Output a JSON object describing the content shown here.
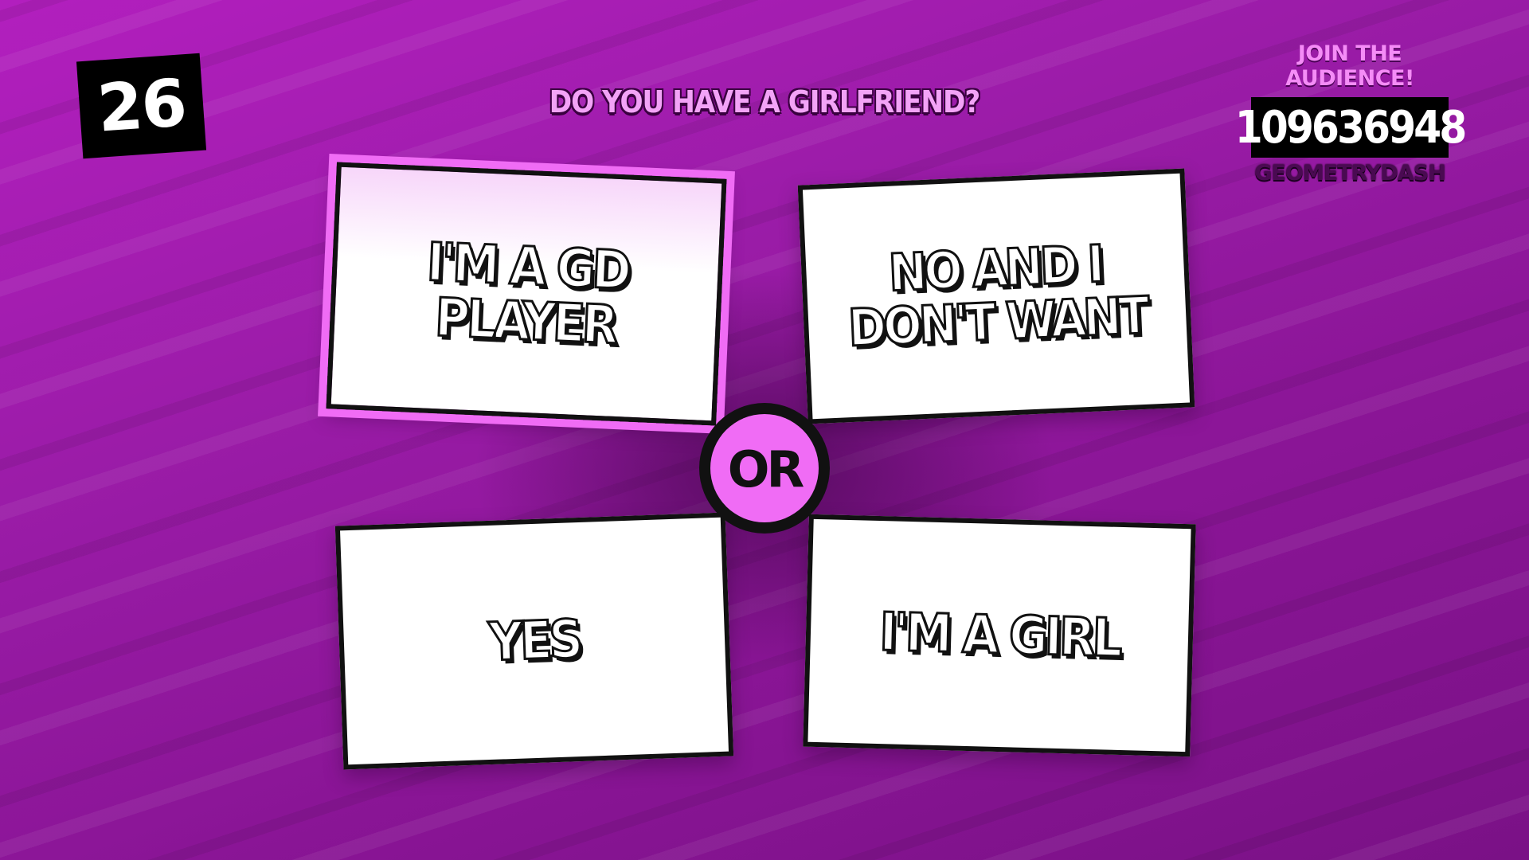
{
  "timer": {
    "seconds": "26"
  },
  "prompt": {
    "text": "DO YOU HAVE A GIRLFRIEND?"
  },
  "audience": {
    "join_label": "JOIN THE AUDIENCE!",
    "code": "109636948",
    "room_name": "GEOMETRYDASH"
  },
  "answers": [
    {
      "label": "I'M A GD PLAYER",
      "selected": true
    },
    {
      "label": "NO AND I DON'T WANT",
      "selected": false
    },
    {
      "label": "YES",
      "selected": false
    },
    {
      "label": "I'M A GIRL",
      "selected": false
    }
  ],
  "divider": {
    "label": "OR"
  },
  "colors": {
    "background": "#9b1ca8",
    "accent_pink": "#f06cf5",
    "prompt_text": "#f3a3f7",
    "card": "#ffffff",
    "outline": "#111111"
  }
}
